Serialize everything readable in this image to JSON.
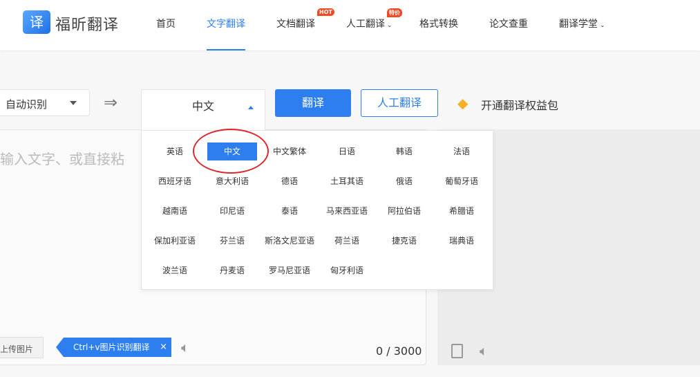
{
  "header": {
    "logo_glyph": "译",
    "brand": "福昕翻译",
    "nav": [
      {
        "label": "首页"
      },
      {
        "label": "文字翻译",
        "active": true
      },
      {
        "label": "文档翻译",
        "badge": "HOT"
      },
      {
        "label": "人工翻译",
        "badge": "特价",
        "dropdown": true
      },
      {
        "label": "格式转换"
      },
      {
        "label": "论文查重"
      },
      {
        "label": "翻译学堂",
        "dropdown": true
      }
    ]
  },
  "toolbar": {
    "source_lang": "自动识别",
    "target_lang": "中文",
    "translate_button": "翻译",
    "human_button": "人工翻译",
    "vip_label": "开通翻译权益包"
  },
  "input": {
    "placeholder": "输入文字、或直接粘",
    "upload_label": "上传图片",
    "tip": "Ctrl+v图片识别翻译",
    "tip_close": "×",
    "count": "0 / 3000"
  },
  "languages": [
    "英语",
    "中文",
    "中文繁体",
    "日语",
    "韩语",
    "法语",
    "西班牙语",
    "意大利语",
    "德语",
    "土耳其语",
    "俄语",
    "葡萄牙语",
    "越南语",
    "印尼语",
    "泰语",
    "马来西亚语",
    "阿拉伯语",
    "希腊语",
    "保加利亚语",
    "芬兰语",
    "斯洛文尼亚语",
    "荷兰语",
    "捷克语",
    "瑞典语",
    "波兰语",
    "丹麦语",
    "罗马尼亚语",
    "匈牙利语"
  ],
  "selected_language": "中文",
  "colors": {
    "accent": "#2d7ff0",
    "highlight_circle": "#e0262b",
    "badge": "#f04a22"
  }
}
